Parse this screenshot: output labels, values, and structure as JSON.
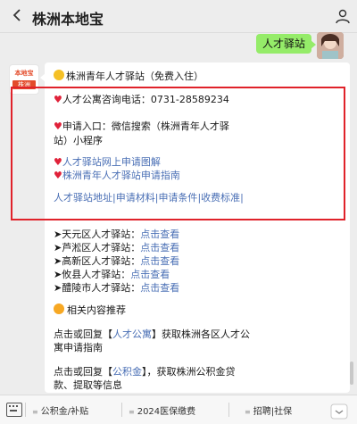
{
  "header": {
    "title": "株洲本地宝",
    "back_icon": "chevron-left-icon",
    "profile_icon": "profile-icon"
  },
  "user_message": {
    "text": "人才驿站"
  },
  "bot": {
    "avatar_top": "本地宝",
    "avatar_bottom": "株洲",
    "intro": "株洲青年人才驿站（免费入住）",
    "phone_line": "人才公寓咨询电话：0731-28589234",
    "apply_line1": "申请入口：微信搜索（株洲青年人才驿",
    "apply_line2": "站）小程序",
    "link1": "人才驿站网上申请图解",
    "link2": "株洲青年人才驿站申请指南",
    "nav_links": [
      "人才驿站地址",
      "申请材料",
      "申请条件",
      "收费标准"
    ],
    "districts": [
      {
        "label": "天元区人才驿站：",
        "action": "点击查看"
      },
      {
        "label": "芦淞区人才驿站：",
        "action": "点击查看"
      },
      {
        "label": "高新区人才驿站：",
        "action": "点击查看"
      },
      {
        "label": "攸县人才驿站：",
        "action": "点击查看"
      },
      {
        "label": "醴陵市人才驿站：",
        "action": "点击查看"
      }
    ],
    "related_heading": "相关内容推荐",
    "reply1_pre": "点击或回复【",
    "reply1_link": "人才公寓",
    "reply1_post": "】获取株洲各区人才公",
    "reply1_line2": "寓申请指南",
    "reply2_pre": "点击或回复【",
    "reply2_link": "公积金",
    "reply2_post": "】，获取株洲公积金贷",
    "reply2_line2": "款、提取等信息"
  },
  "bottom_menu": {
    "items": [
      "公积金/补贴",
      "2024医保缴费",
      "招聘|社保"
    ]
  },
  "colors": {
    "accent_red": "#e0222a",
    "link_blue": "#4a6fb5",
    "user_bubble": "#95ec69"
  }
}
